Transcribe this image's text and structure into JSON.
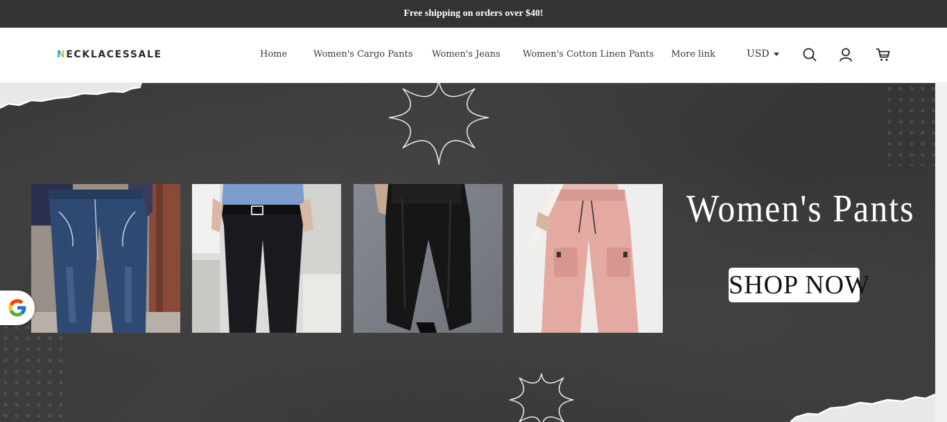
{
  "announcement": {
    "text": "Free shipping on orders over $40!"
  },
  "header": {
    "logo_text": "ECKLACESSALE",
    "logo_initial": "N",
    "nav": [
      {
        "label": "Home"
      },
      {
        "label": "Women's Cargo Pants"
      },
      {
        "label": "Women's Jeans"
      },
      {
        "label": "Women's Cotton Linen Pants"
      },
      {
        "label": "More link"
      }
    ],
    "currency": "USD",
    "icons": [
      "search-icon",
      "account-icon",
      "cart-icon"
    ]
  },
  "hero": {
    "title": "Women's Pants",
    "cta_label": "SHOP NOW",
    "products": [
      {
        "name": "bootcut-jeans",
        "color": "#2f4a72"
      },
      {
        "name": "black-trousers",
        "color": "#1a1a1e"
      },
      {
        "name": "black-linen-pants",
        "color": "#161616"
      },
      {
        "name": "pink-cargo-pants",
        "color": "#e4aaa2"
      }
    ]
  },
  "colors": {
    "announcement_bg": "#333333",
    "hero_bg": "#3a3a3a",
    "logo_blue": "#1fa6d6",
    "logo_yellow": "#f1b51c"
  }
}
